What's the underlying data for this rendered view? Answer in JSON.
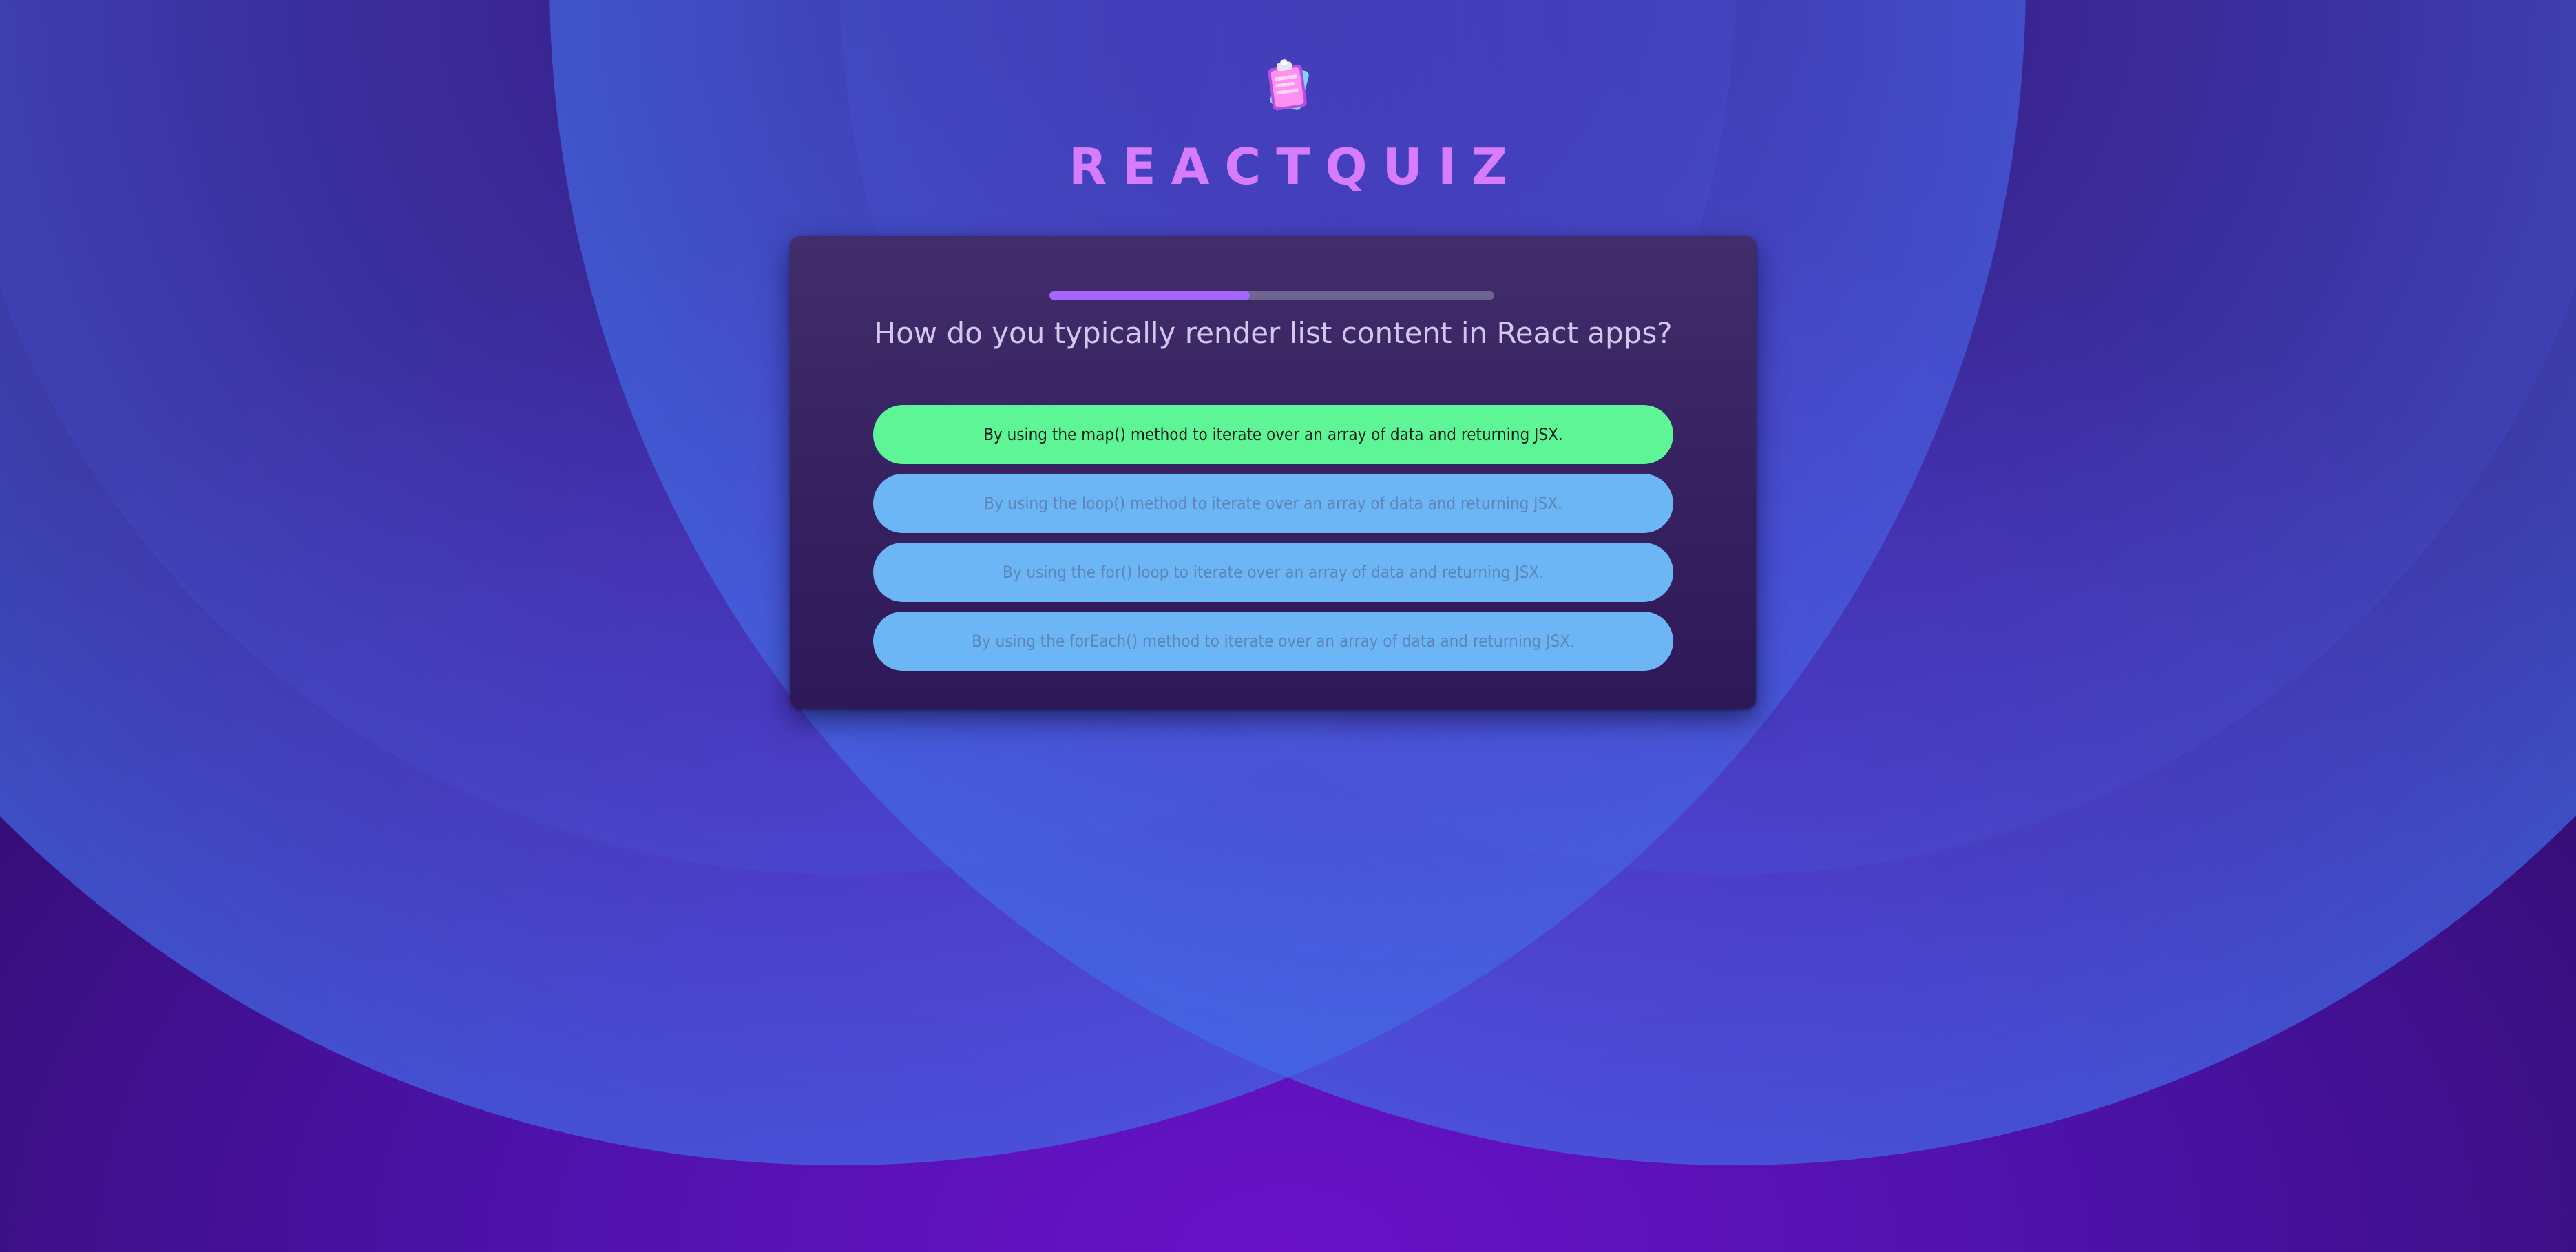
{
  "app": {
    "title": "REACTQUIZ",
    "logo_icon": "clipboard-icon"
  },
  "quiz": {
    "progress": 0.45,
    "question": "How do you typically render list content in React apps?",
    "answers": [
      {
        "label": "By using the map() method to iterate over an array of data and returning JSX.",
        "state": "correct"
      },
      {
        "label": "By using the loop() method to iterate over an array of data and returning JSX.",
        "state": "inactive"
      },
      {
        "label": "By using the for() loop to iterate over an array of data and returning JSX.",
        "state": "inactive"
      },
      {
        "label": "By using the forEach() method to iterate over an array of data and returning JSX.",
        "state": "inactive"
      }
    ]
  },
  "colors": {
    "accent_title": "#d77cff",
    "correct_answer": "#5ef597",
    "answer_default": "#6cb6f5",
    "progress_fill": "#a566ff",
    "progress_track": "#6e6690"
  }
}
